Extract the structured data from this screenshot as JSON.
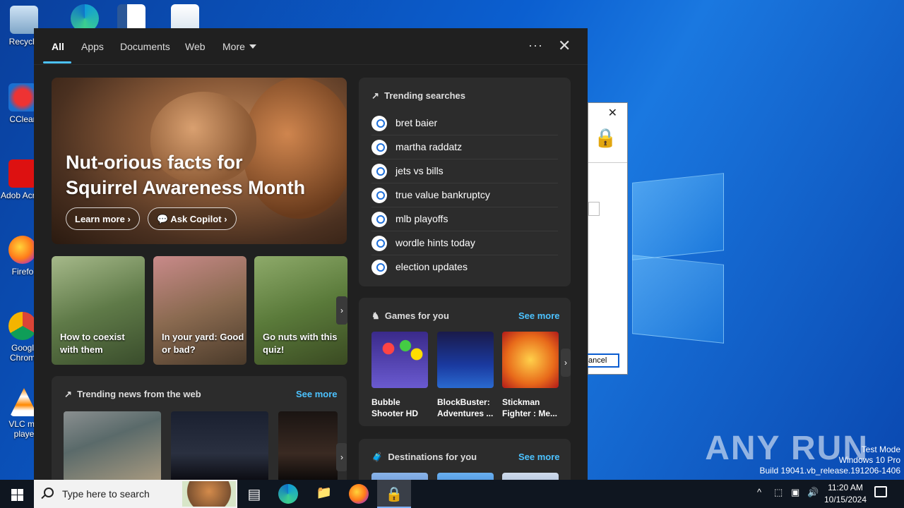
{
  "desktop": {
    "icons": [
      {
        "label": "Recycle"
      },
      {
        "label": "CClear"
      },
      {
        "label": "Adob Acrob"
      },
      {
        "label": "Firefo"
      },
      {
        "label": "Googl Chrom"
      },
      {
        "label": "VLC me playe"
      }
    ],
    "watermark": "ANY RUN",
    "test_mode": [
      "Test Mode",
      "Windows 10 Pro",
      "Build 19041.vb_release.191206-1406"
    ]
  },
  "dialog": {
    "close": "✕",
    "cancel_label": "ancel"
  },
  "search_panel": {
    "tabs": [
      {
        "label": "All",
        "active": true
      },
      {
        "label": "Apps"
      },
      {
        "label": "Documents"
      },
      {
        "label": "Web"
      },
      {
        "label": "More"
      }
    ],
    "more_options": "···",
    "close": "✕",
    "hero": {
      "title_line1": "Nut-orious facts for",
      "title_line2": "Squirrel Awareness Month",
      "learn_more": "Learn more",
      "ask_copilot": "Ask Copilot"
    },
    "cards": [
      {
        "caption": "How to coexist with them"
      },
      {
        "caption": "In your yard: Good or bad?"
      },
      {
        "caption": "Go nuts with this quiz!"
      }
    ],
    "news": {
      "title": "Trending news from the web",
      "see_more": "See more"
    },
    "trending": {
      "title": "Trending searches",
      "items": [
        "bret baier",
        "martha raddatz",
        "jets vs bills",
        "true value bankruptcy",
        "mlb playoffs",
        "wordle hints today",
        "election updates"
      ]
    },
    "games": {
      "title": "Games for you",
      "see_more": "See more",
      "items": [
        {
          "name": "Bubble Shooter HD"
        },
        {
          "name": "BlockBuster: Adventures ..."
        },
        {
          "name": "Stickman Fighter : Me..."
        }
      ]
    },
    "destinations": {
      "title": "Destinations for you",
      "see_more": "See more"
    }
  },
  "taskbar": {
    "search_placeholder": "Type here to search",
    "time": "11:20 AM",
    "date": "10/15/2024"
  }
}
